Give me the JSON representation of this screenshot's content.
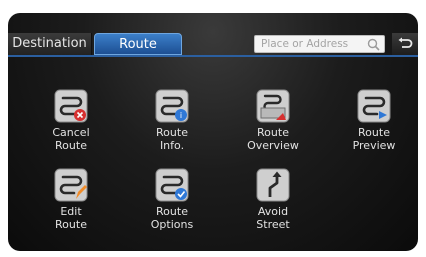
{
  "tabs": {
    "destination": "Destination",
    "route": "Route"
  },
  "search": {
    "placeholder": "Place or Address"
  },
  "menu": [
    {
      "label": "Cancel\nRoute",
      "icon": "cancel-route-icon"
    },
    {
      "label": "Route\nInfo.",
      "icon": "route-info-icon"
    },
    {
      "label": "Route\nOverview",
      "icon": "route-overview-icon"
    },
    {
      "label": "Route\nPreview",
      "icon": "route-preview-icon"
    },
    {
      "label": "Edit\nRoute",
      "icon": "edit-route-icon"
    },
    {
      "label": "Route\nOptions",
      "icon": "route-options-icon"
    },
    {
      "label": "Avoid\nStreet",
      "icon": "avoid-street-icon"
    }
  ],
  "colors": {
    "accent": "#2b6cc0",
    "cancel_badge": "#d63030",
    "info_badge": "#2f78d6",
    "edit_badge": "#f08c2a"
  }
}
